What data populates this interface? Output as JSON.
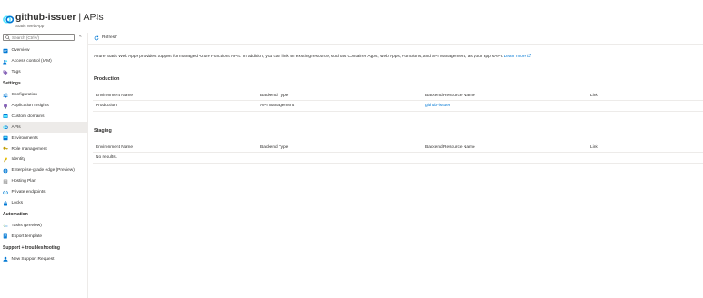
{
  "header": {
    "resource_name": "github-issuer",
    "separator": " | ",
    "page_name": "APIs",
    "subtitle": "Static Web App",
    "more": "…"
  },
  "sidebar": {
    "search_placeholder": "Search (Ctrl+/)",
    "collapse": "«",
    "top_items": [
      {
        "label": "Overview",
        "icon": "overview-icon",
        "color": "#0078d4"
      },
      {
        "label": "Access control (IAM)",
        "icon": "people-icon",
        "color": "#0078d4"
      },
      {
        "label": "Tags",
        "icon": "tag-icon",
        "color": "#8764b8"
      }
    ],
    "sections": [
      {
        "title": "Settings",
        "items": [
          {
            "label": "Configuration",
            "icon": "sliders-icon",
            "color": "#0078d4"
          },
          {
            "label": "Application Insights",
            "icon": "bulb-icon",
            "color": "#8764b8"
          },
          {
            "label": "Custom domains",
            "icon": "globe-icon",
            "color": "#0078d4"
          },
          {
            "label": "APIs",
            "icon": "api-icon",
            "color": "#0078d4",
            "active": true
          },
          {
            "label": "Environments",
            "icon": "environment-icon",
            "color": "#0078d4"
          },
          {
            "label": "Role management",
            "icon": "key-icon",
            "color": "#c19c00"
          },
          {
            "label": "Identity",
            "icon": "identity-icon",
            "color": "#c19c00"
          },
          {
            "label": "Enterprise-grade edge (Preview)",
            "icon": "edge-icon",
            "color": "#0078d4"
          },
          {
            "label": "Hosting Plan",
            "icon": "plan-icon",
            "color": "#0078d4"
          },
          {
            "label": "Private endpoints",
            "icon": "endpoint-icon",
            "color": "#0078d4"
          },
          {
            "label": "Locks",
            "icon": "lock-icon",
            "color": "#0078d4"
          }
        ]
      },
      {
        "title": "Automation",
        "items": [
          {
            "label": "Tasks (preview)",
            "icon": "tasks-icon",
            "color": "#0078d4"
          },
          {
            "label": "Export template",
            "icon": "export-icon",
            "color": "#0078d4"
          }
        ]
      },
      {
        "title": "Support + troubleshooting",
        "items": [
          {
            "label": "New Support Request",
            "icon": "support-icon",
            "color": "#0078d4"
          }
        ]
      }
    ]
  },
  "toolbar": {
    "refresh_label": "Refresh"
  },
  "content": {
    "intro_text": "Azure Static Web Apps provides support for managed Azure Functions APIs. In addition, you can link an existing resource, such as Container Apps, Web Apps, Functions, and API Management, as your app's API.",
    "learn_more": "Learn more",
    "columns": [
      "Environment Name",
      "Backend Type",
      "Backend Resource Name",
      "Link"
    ],
    "production": {
      "heading": "Production",
      "row": {
        "environment": "Production",
        "backend_type": "API Management",
        "backend_resource": "github-issuer",
        "link": ""
      }
    },
    "staging": {
      "heading": "Staging",
      "empty_text": "No results."
    }
  },
  "colors": {
    "accent": "#0078d4",
    "active_bg": "#edebe9",
    "text": "#323130",
    "muted": "#605e5c"
  }
}
